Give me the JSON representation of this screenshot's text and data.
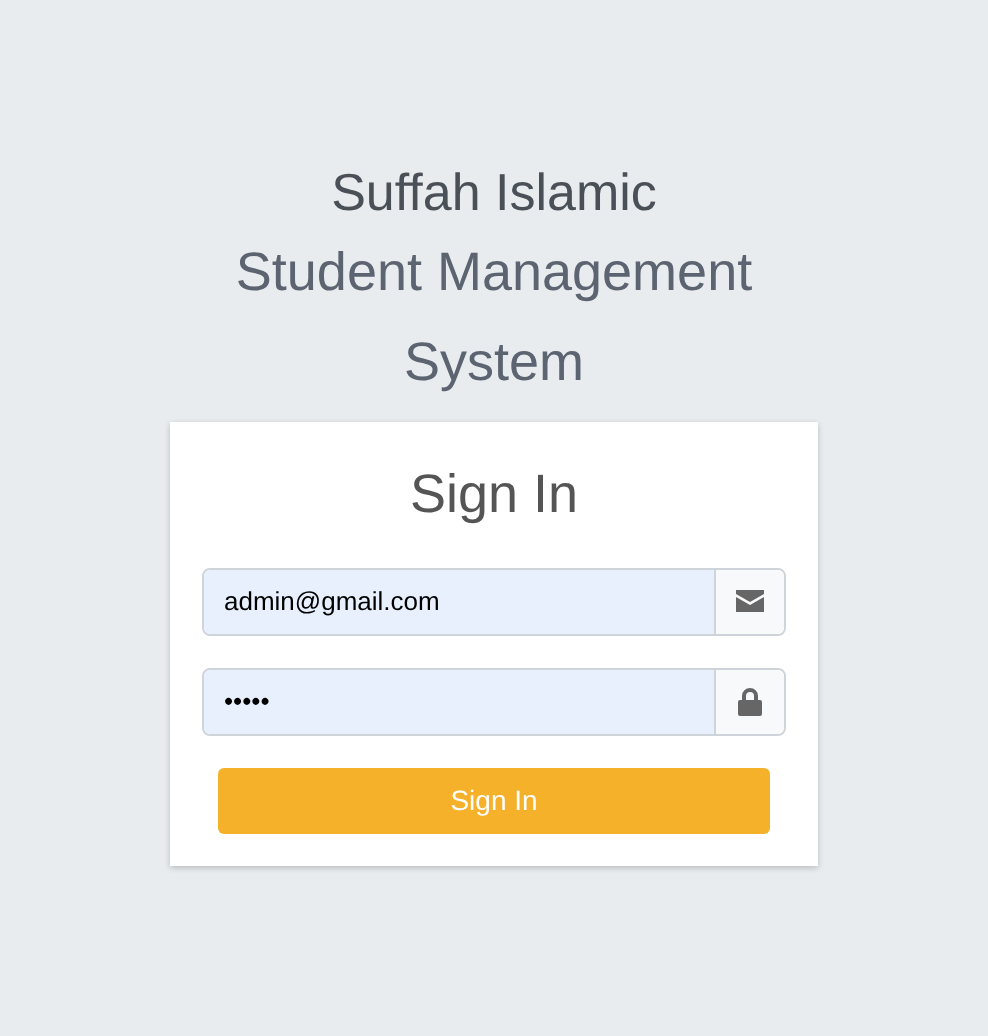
{
  "header": {
    "title": "Suffah Islamic",
    "subtitle": "Student Management System"
  },
  "form": {
    "heading": "Sign In",
    "fields": [
      {
        "kind": "email",
        "value": "admin@gmail.com"
      },
      {
        "kind": "password",
        "value": "•••••"
      }
    ],
    "button": "Sign In"
  }
}
